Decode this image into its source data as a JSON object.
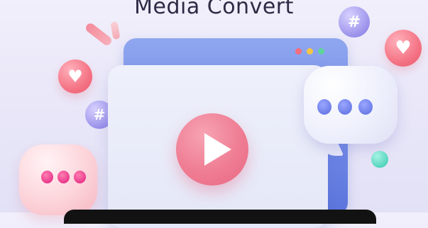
{
  "title": "Media Convert",
  "icons": {
    "play": "play-icon",
    "heart": "heart-icon",
    "hashtag": "hashtag-icon",
    "chat": "chat-bubble-icon"
  },
  "glyphs": {
    "heart": "♥",
    "hash": "#"
  },
  "colors": {
    "window_blue": "#6f88e6",
    "play_pink": "#ef7d93",
    "dot_red": "#f26d7d",
    "dot_yellow": "#f6c544",
    "dot_green": "#5ed49a"
  }
}
